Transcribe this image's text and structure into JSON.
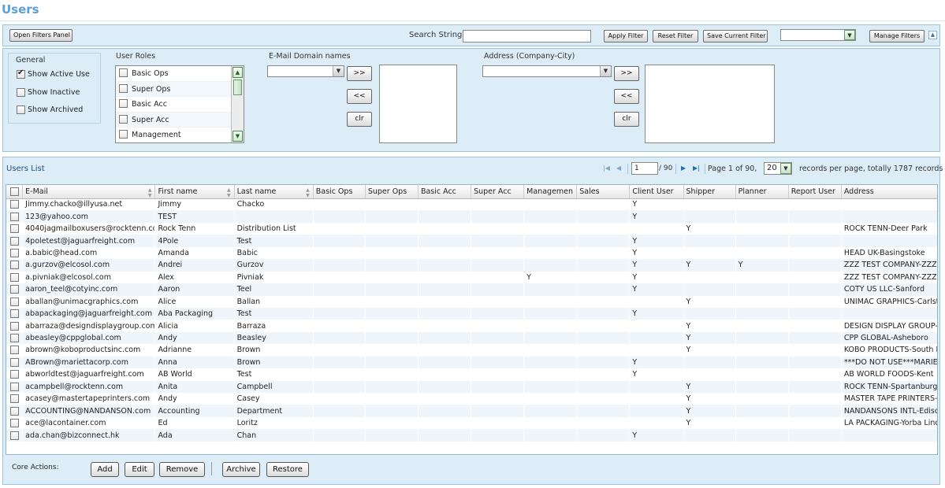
{
  "page": {
    "title": "Users"
  },
  "toolbar": {
    "open_filters_label": "Open Filters Panel",
    "search_label": "Search String",
    "search_value": "",
    "apply_filter_label": "Apply Filter",
    "reset_filter_label": "Reset Filter",
    "save_filter_label": "Save Current Filter",
    "saved_filter_value": "",
    "manage_filters_label": "Manage Filters",
    "collapse_icon": "chevron-up-icon"
  },
  "filters": {
    "general": {
      "title": "General",
      "options": [
        {
          "label": "Show Active Use",
          "checked": true
        },
        {
          "label": "Show Inactive",
          "checked": false
        },
        {
          "label": "Show Archived",
          "checked": false
        }
      ]
    },
    "roles": {
      "title": "User Roles",
      "items": [
        "Basic Ops",
        "Super Ops",
        "Basic Acc",
        "Super Acc",
        "Management"
      ]
    },
    "email": {
      "title": "E-Mail Domain names",
      "select_value": "",
      "add_label": ">>",
      "remove_label": "<<",
      "clear_label": "clr"
    },
    "address": {
      "title": "Address (Company-City)",
      "select_value": "",
      "add_label": ">>",
      "remove_label": "<<",
      "clear_label": "clr"
    }
  },
  "list": {
    "title": "Users List",
    "pager": {
      "page_input": "1",
      "total_pages_text": "/ 90",
      "page_info": "Page 1 of 90,",
      "page_size": "20",
      "records_info": "records per page, totally 1787 records"
    },
    "columns": [
      "E-Mail",
      "First name",
      "Last name",
      "Basic Ops",
      "Super Ops",
      "Basic Acc",
      "Super Acc",
      "Managemen",
      "Sales",
      "Client User",
      "Shipper",
      "Planner",
      "Report User",
      "Address"
    ],
    "rows": [
      [
        "Jimmy.chacko@illyusa.net",
        "Jimmy",
        "Chacko",
        "",
        "",
        "",
        "",
        "",
        "",
        "Y",
        "",
        "",
        "",
        ""
      ],
      [
        "123@yahoo.com",
        "TEST",
        "",
        "",
        "",
        "",
        "",
        "",
        "",
        "Y",
        "",
        "",
        "",
        ""
      ],
      [
        "4040jagmailboxusers@rocktenn.com",
        "Rock Tenn",
        "Distribution List",
        "",
        "",
        "",
        "",
        "",
        "",
        "",
        "Y",
        "",
        "",
        "ROCK TENN-Deer Park"
      ],
      [
        "4poletest@jaguarfreight.com",
        "4Pole",
        "Test",
        "",
        "",
        "",
        "",
        "",
        "",
        "Y",
        "",
        "",
        "",
        ""
      ],
      [
        "a.babic@head.com",
        "Amanda",
        "Babic",
        "",
        "",
        "",
        "",
        "",
        "",
        "Y",
        "",
        "",
        "",
        "HEAD UK-Basingstoke"
      ],
      [
        "a.gurzov@elcosol.com",
        "Andrei",
        "Gurzov",
        "",
        "",
        "",
        "",
        "",
        "",
        "Y",
        "Y",
        "Y",
        "",
        "ZZZ TEST COMPANY-ZZZ test city"
      ],
      [
        "a.pivniak@elcosol.com",
        "Alex",
        "Pivniak",
        "",
        "",
        "",
        "",
        "Y",
        "",
        "Y",
        "",
        "",
        "",
        "ZZZ TEST COMPANY-ZZZ test city"
      ],
      [
        "aaron_teel@cotyinc.com",
        "Aaron",
        "Teel",
        "",
        "",
        "",
        "",
        "",
        "",
        "Y",
        "",
        "",
        "",
        "COTY US LLC-Sanford"
      ],
      [
        "aballan@unimacgraphics.com",
        "Alice",
        "Ballan",
        "",
        "",
        "",
        "",
        "",
        "",
        "",
        "Y",
        "",
        "",
        "UNIMAC GRAPHICS-Carlstadt"
      ],
      [
        "abapackaging@jaguarfreight.com",
        "Aba Packaging",
        "Test",
        "",
        "",
        "",
        "",
        "",
        "",
        "Y",
        "",
        "",
        "",
        ""
      ],
      [
        "abarraza@designdisplaygroup.com",
        "Alicia",
        "Barraza",
        "",
        "",
        "",
        "",
        "",
        "",
        "",
        "Y",
        "",
        "",
        "DESIGN DISPLAY GROUP-Carlstadt"
      ],
      [
        "abeasley@cppglobal.com",
        "Andy",
        "Beasley",
        "",
        "",
        "",
        "",
        "",
        "",
        "",
        "Y",
        "",
        "",
        "CPP GLOBAL-Asheboro"
      ],
      [
        "abrown@koboproductsinc.com",
        "Adrianne",
        "Brown",
        "",
        "",
        "",
        "",
        "",
        "",
        "",
        "Y",
        "",
        "",
        "KOBO PRODUCTS-South Plainfield"
      ],
      [
        "ABrown@mariettacorp.com",
        "Anna",
        "Brown",
        "",
        "",
        "",
        "",
        "",
        "",
        "Y",
        "",
        "",
        "",
        "***DO NOT USE***MARIETTA CORP"
      ],
      [
        "abworldtest@jaguarfreight.com",
        "AB World",
        "Test",
        "",
        "",
        "",
        "",
        "",
        "",
        "Y",
        "",
        "",
        "",
        "AB WORLD FOODS-Kent"
      ],
      [
        "acampbell@rocktenn.com",
        "Anita",
        "Campbell",
        "",
        "",
        "",
        "",
        "",
        "",
        "",
        "Y",
        "",
        "",
        "ROCK TENN-Spartanburg"
      ],
      [
        "acasey@mastertapeprinters.com",
        "Andy",
        "Casey",
        "",
        "",
        "",
        "",
        "",
        "",
        "",
        "Y",
        "",
        "",
        "MASTER TAPE PRINTERS-Chicago"
      ],
      [
        "ACCOUNTING@NANDANSON.com",
        "Accounting",
        "Department",
        "",
        "",
        "",
        "",
        "",
        "",
        "",
        "Y",
        "",
        "",
        "NANDANSONS INTL-Edison"
      ],
      [
        "ace@lacontainer.com",
        "Ed",
        "Loritz",
        "",
        "",
        "",
        "",
        "",
        "",
        "",
        "Y",
        "",
        "",
        "LA PACKAGING-Yorba Linda"
      ],
      [
        "ada.chan@bizconnect.hk",
        "Ada",
        "Chan",
        "",
        "",
        "",
        "",
        "",
        "",
        "Y",
        "",
        "",
        "",
        ""
      ]
    ]
  },
  "actions": {
    "title": "Core Actions:",
    "add_label": "Add",
    "edit_label": "Edit",
    "remove_label": "Remove",
    "archive_label": "Archive",
    "restore_label": "Restore"
  }
}
